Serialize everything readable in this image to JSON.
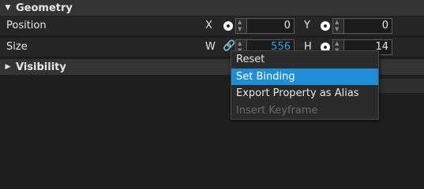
{
  "geometry": {
    "title": "Geometry",
    "position": {
      "label": "Position",
      "x_label": "X",
      "x_value": "0",
      "y_label": "Y",
      "y_value": "0"
    },
    "size": {
      "label": "Size",
      "w_label": "W",
      "w_value": "556",
      "h_label": "H",
      "h_value": "14"
    }
  },
  "visibility": {
    "title": "Visibility"
  },
  "context_menu": {
    "items": [
      {
        "label": "Reset",
        "state": "normal"
      },
      {
        "label": "Set Binding",
        "state": "highlighted"
      },
      {
        "label": "Export Property as Alias",
        "state": "normal"
      },
      {
        "label": "Insert Keyframe",
        "state": "disabled"
      }
    ]
  },
  "colors": {
    "accent": "#1e8fd6",
    "link": "#2e9fe0",
    "background": "#1e1e1e",
    "header": "#343434"
  },
  "icons": {
    "expanded": "triangle-down-icon",
    "collapsed": "triangle-right-icon",
    "keyframe": "circle-icon",
    "binding": "link-icon"
  }
}
